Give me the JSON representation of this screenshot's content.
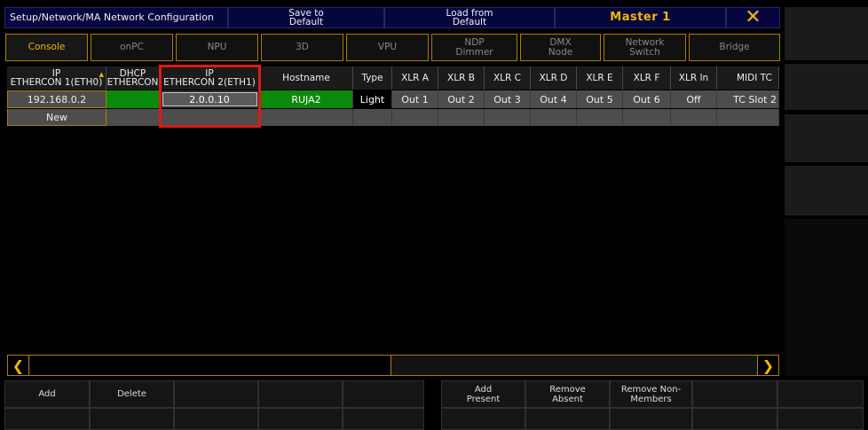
{
  "window": {
    "title": "Setup/Network/MA Network Configuration",
    "save_default": "Save to Default",
    "load_default": "Load from Default",
    "master": "Master 1",
    "close_icon": "close-x-icon"
  },
  "tabs": [
    {
      "label": "Console"
    },
    {
      "label": "onPC"
    },
    {
      "label": "NPU"
    },
    {
      "label": "3D"
    },
    {
      "label": "VPU"
    },
    {
      "label": "NDP Dimmer"
    },
    {
      "label": "DMX Node"
    },
    {
      "label": "Network Switch"
    },
    {
      "label": "Bridge"
    }
  ],
  "table": {
    "headers": [
      "IP ETHERCON 1(ETH0)",
      "DHCP ETHERCON",
      "IP ETHERCON 2(ETH1)",
      "Hostname",
      "Type",
      "XLR A",
      "XLR B",
      "XLR C",
      "XLR D",
      "XLR E",
      "XLR F",
      "XLR In",
      "MIDI TC"
    ],
    "header_lines": [
      [
        "IP",
        "ETHERCON 1(ETH0)"
      ],
      [
        "DHCP",
        "ETHERCON"
      ],
      [
        "IP",
        "ETHERCON 2(ETH1)"
      ],
      [
        "Hostname"
      ],
      [
        "Type"
      ],
      [
        "XLR A"
      ],
      [
        "XLR B"
      ],
      [
        "XLR C"
      ],
      [
        "XLR D"
      ],
      [
        "XLR E"
      ],
      [
        "XLR F"
      ],
      [
        "XLR In"
      ],
      [
        "MIDI TC"
      ]
    ],
    "row": [
      "192.168.0.2",
      "",
      "2.0.0.10",
      "RUJA2",
      "Light",
      "Out 1",
      "Out 2",
      "Out 3",
      "Out 4",
      "Out 5",
      "Out 6",
      "Off",
      "TC Slot 2"
    ],
    "new_label": "New"
  },
  "scroll": {
    "left_icon": "chevron-left-icon",
    "right_icon": "chevron-right-icon"
  },
  "bottom": {
    "add": "Add",
    "delete": "Delete",
    "add_present": "Add Present",
    "remove_absent": "Remove Absent",
    "remove_non_members": "Remove Non-Members"
  },
  "colors": {
    "accent": "#f5b800",
    "title_bg": "#06063f",
    "green_cell": "#0a8a0a",
    "highlight": "#e01818"
  }
}
